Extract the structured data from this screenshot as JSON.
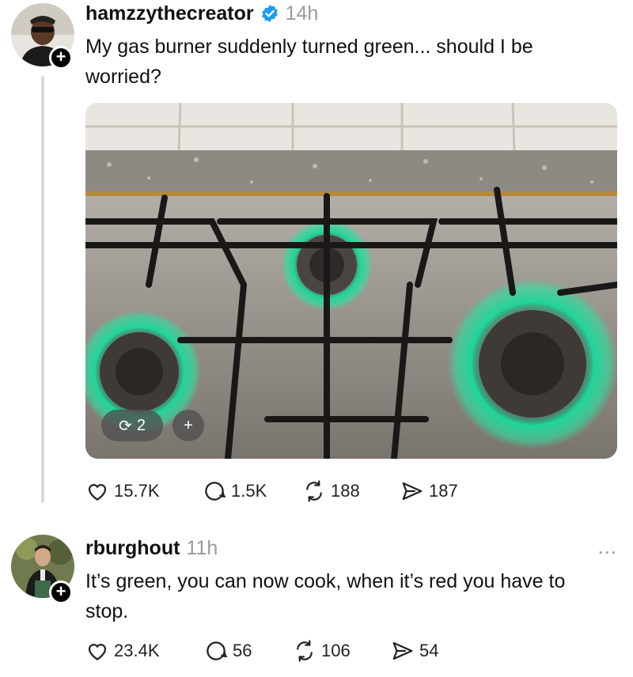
{
  "post": {
    "username": "hamzzythecreator",
    "time": "14h",
    "text": "My gas burner suddenly turned green... should I be worried?",
    "media": {
      "repost_count": "2",
      "plus_label": "+",
      "description_icon": "photo"
    },
    "actions": {
      "likes": "15.7K",
      "replies": "1.5K",
      "reposts": "188",
      "shares": "187"
    }
  },
  "reply": {
    "username": "rburghout",
    "time": "11h",
    "text": "It’s green, you can now cook, when it’s red you have to stop.",
    "more": "...",
    "actions": {
      "likes": "23.4K",
      "replies": "56",
      "reposts": "106",
      "shares": "54"
    }
  },
  "colors": {
    "verified": "#1d9bf0",
    "flame": "#2fe0a0",
    "muted": "#9a9a9a"
  }
}
